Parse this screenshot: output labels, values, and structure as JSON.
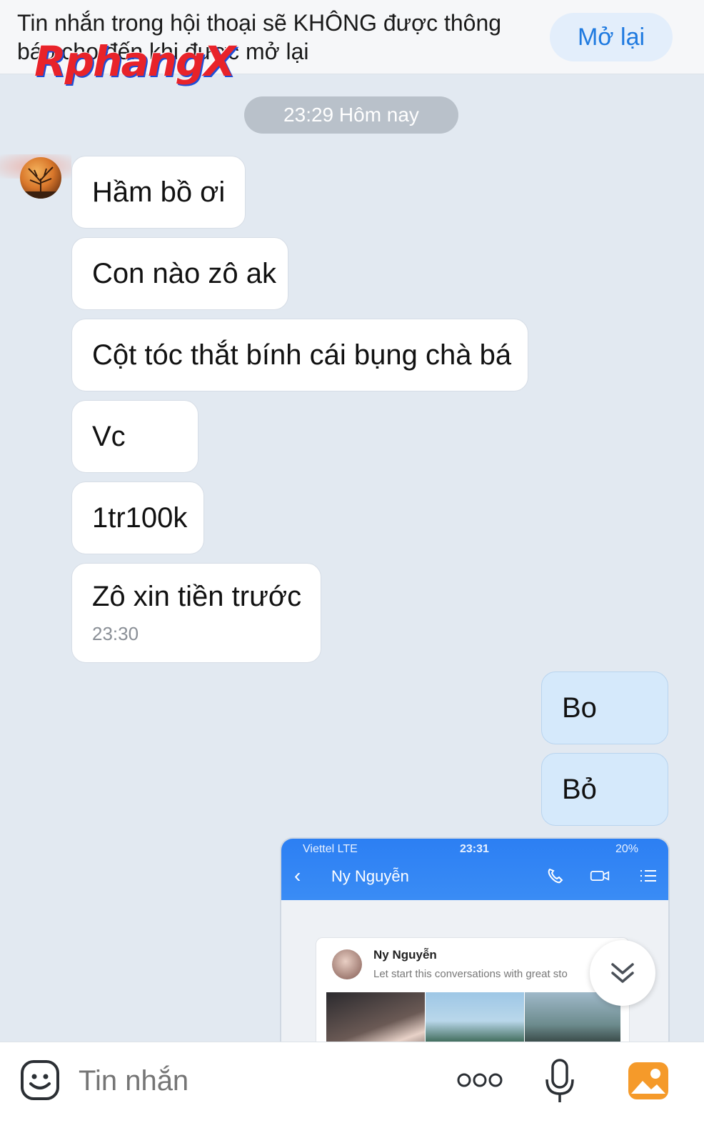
{
  "notice": {
    "text": "Tin nhắn trong hội thoại sẽ KHÔNG được thông báo cho đến khi được mở lại",
    "reopen_label": "Mở lại"
  },
  "watermark": "RphangX",
  "time_divider": "23:29 Hôm nay",
  "messages": [
    {
      "from": "received",
      "text": "Hầm bồ ơi"
    },
    {
      "from": "received",
      "text": "Con nào zô ak"
    },
    {
      "from": "received",
      "text": "Cột tóc thắt bính cái bụng chà bá"
    },
    {
      "from": "received",
      "text": "Vc"
    },
    {
      "from": "received",
      "text": "1tr100k"
    },
    {
      "from": "received",
      "text": "Zô xin tiền trước",
      "time": "23:30"
    },
    {
      "from": "sent",
      "text": "Bo"
    },
    {
      "from": "sent",
      "text": "Bỏ"
    }
  ],
  "image_message": {
    "carrier": "Viettel  LTE",
    "clock": "23:31",
    "battery": "20%",
    "contact_name": "Ny Nguyễn",
    "card_name": "Ny Nguyễn",
    "card_subtitle": "Let start this conversations with great sto"
  },
  "composer": {
    "placeholder": "Tin nhắn"
  },
  "colors": {
    "accent": "#1f7ae0",
    "background": "#e2e9f1",
    "sent_bubble": "#d5e9fb",
    "gallery_icon": "#f59a2a"
  },
  "icons": [
    "emoji-icon",
    "more-icon",
    "microphone-icon",
    "gallery-icon",
    "chevron-double-down-icon"
  ]
}
